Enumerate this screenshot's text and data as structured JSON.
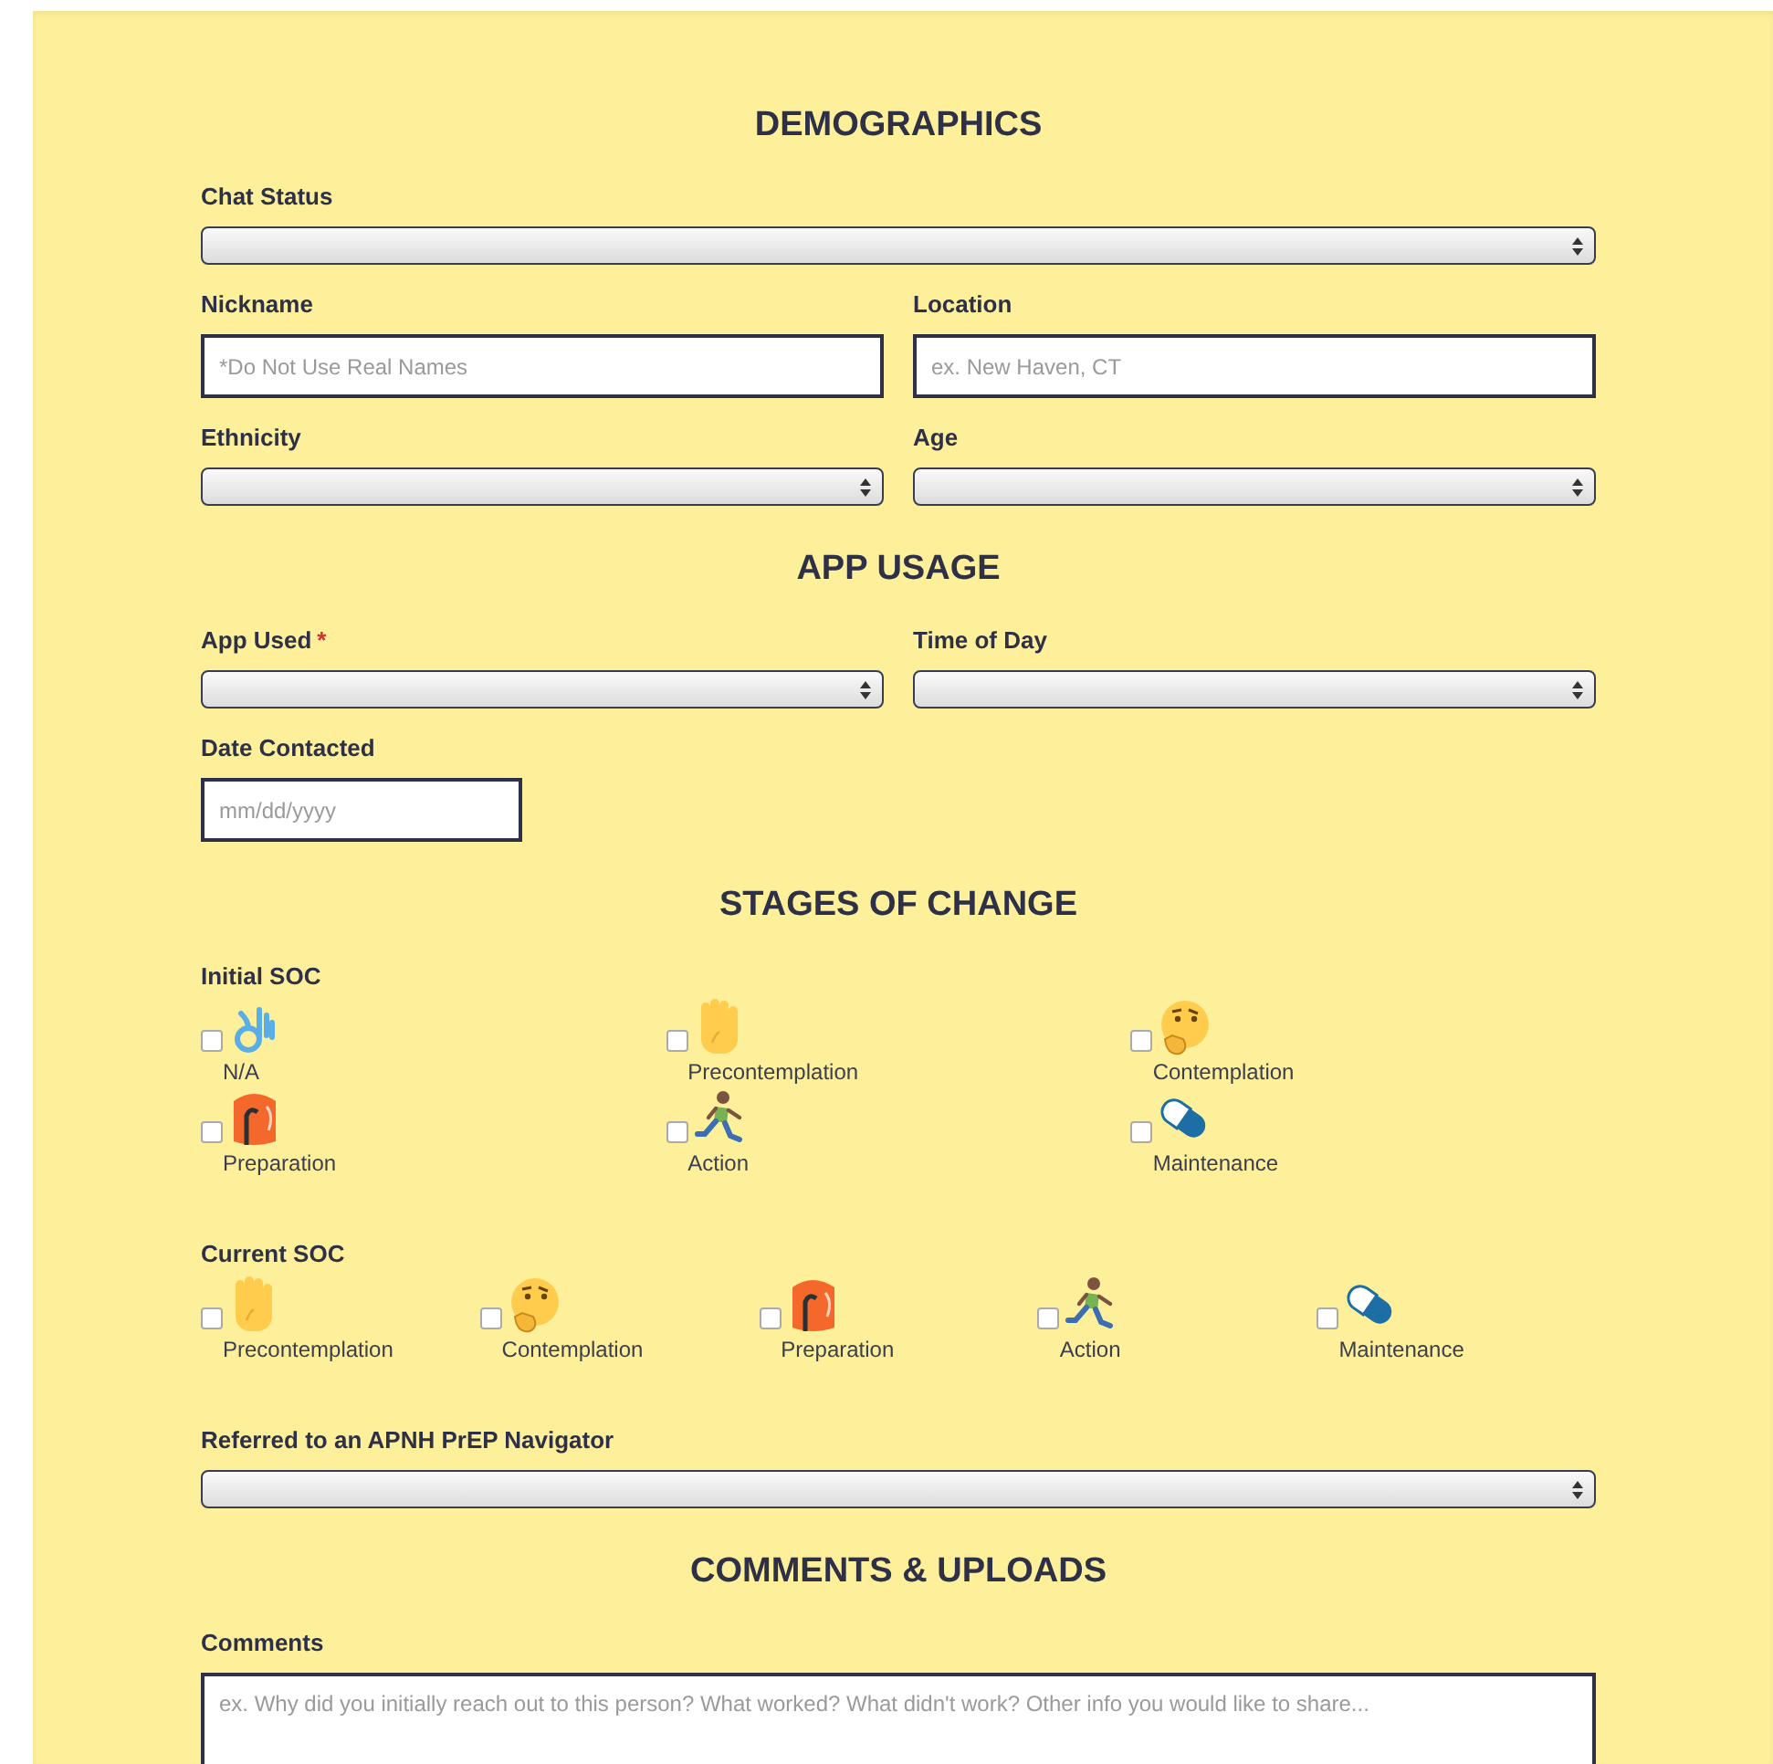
{
  "sections": [
    {
      "title": "DEMOGRAPHICS",
      "rows": [
        [
          {
            "kind": "select",
            "label": "Chat Status"
          }
        ],
        [
          {
            "kind": "text",
            "label": "Nickname",
            "placeholder": "*Do Not Use Real Names"
          },
          {
            "kind": "text",
            "label": "Location",
            "placeholder": "ex. New Haven, CT"
          }
        ],
        [
          {
            "kind": "select",
            "label": "Ethnicity"
          },
          {
            "kind": "select",
            "label": "Age"
          }
        ]
      ]
    },
    {
      "title": "APP USAGE",
      "rows": [
        [
          {
            "kind": "select",
            "label": "App Used",
            "required_mark": "*"
          },
          {
            "kind": "select",
            "label": "Time of Day"
          }
        ],
        [
          {
            "kind": "date",
            "label": "Date Contacted",
            "placeholder": "mm/dd/yyyy"
          }
        ]
      ]
    },
    {
      "title": "STAGES OF CHANGE",
      "rows": [
        [
          {
            "kind": "stages",
            "label": "Initial SOC",
            "options": [
              {
                "kind": "na",
                "label": "N/A",
                "checked": false
              },
              {
                "kind": "precontemplation",
                "label": "Precontemplation",
                "checked": false
              },
              {
                "kind": "contemplation",
                "label": "Contemplation",
                "checked": false
              },
              {
                "kind": "preparation",
                "label": "Preparation",
                "checked": false
              },
              {
                "kind": "action",
                "label": "Action",
                "checked": false
              },
              {
                "kind": "maintenance",
                "label": "Maintenance",
                "checked": false
              }
            ]
          }
        ],
        [
          {
            "kind": "stages",
            "label": "Current SOC",
            "options": [
              {
                "kind": "precontemplation",
                "label": "Precontemplation",
                "checked": false
              },
              {
                "kind": "contemplation",
                "label": "Contemplation",
                "checked": false
              },
              {
                "kind": "preparation",
                "label": "Preparation",
                "checked": false
              },
              {
                "kind": "action",
                "label": "Action",
                "checked": false
              },
              {
                "kind": "maintenance",
                "label": "Maintenance",
                "checked": false
              }
            ]
          }
        ],
        [
          {
            "kind": "select",
            "label": "Referred to an APNH PrEP Navigator"
          }
        ]
      ]
    },
    {
      "title": "COMMENTS & UPLOADS",
      "rows": [
        [
          {
            "kind": "textarea",
            "label": "Comments",
            "placeholder": "ex. Why did you initially reach out to this person? What worked? What didn't work? Other info you would like to share..."
          }
        ]
      ]
    }
  ]
}
